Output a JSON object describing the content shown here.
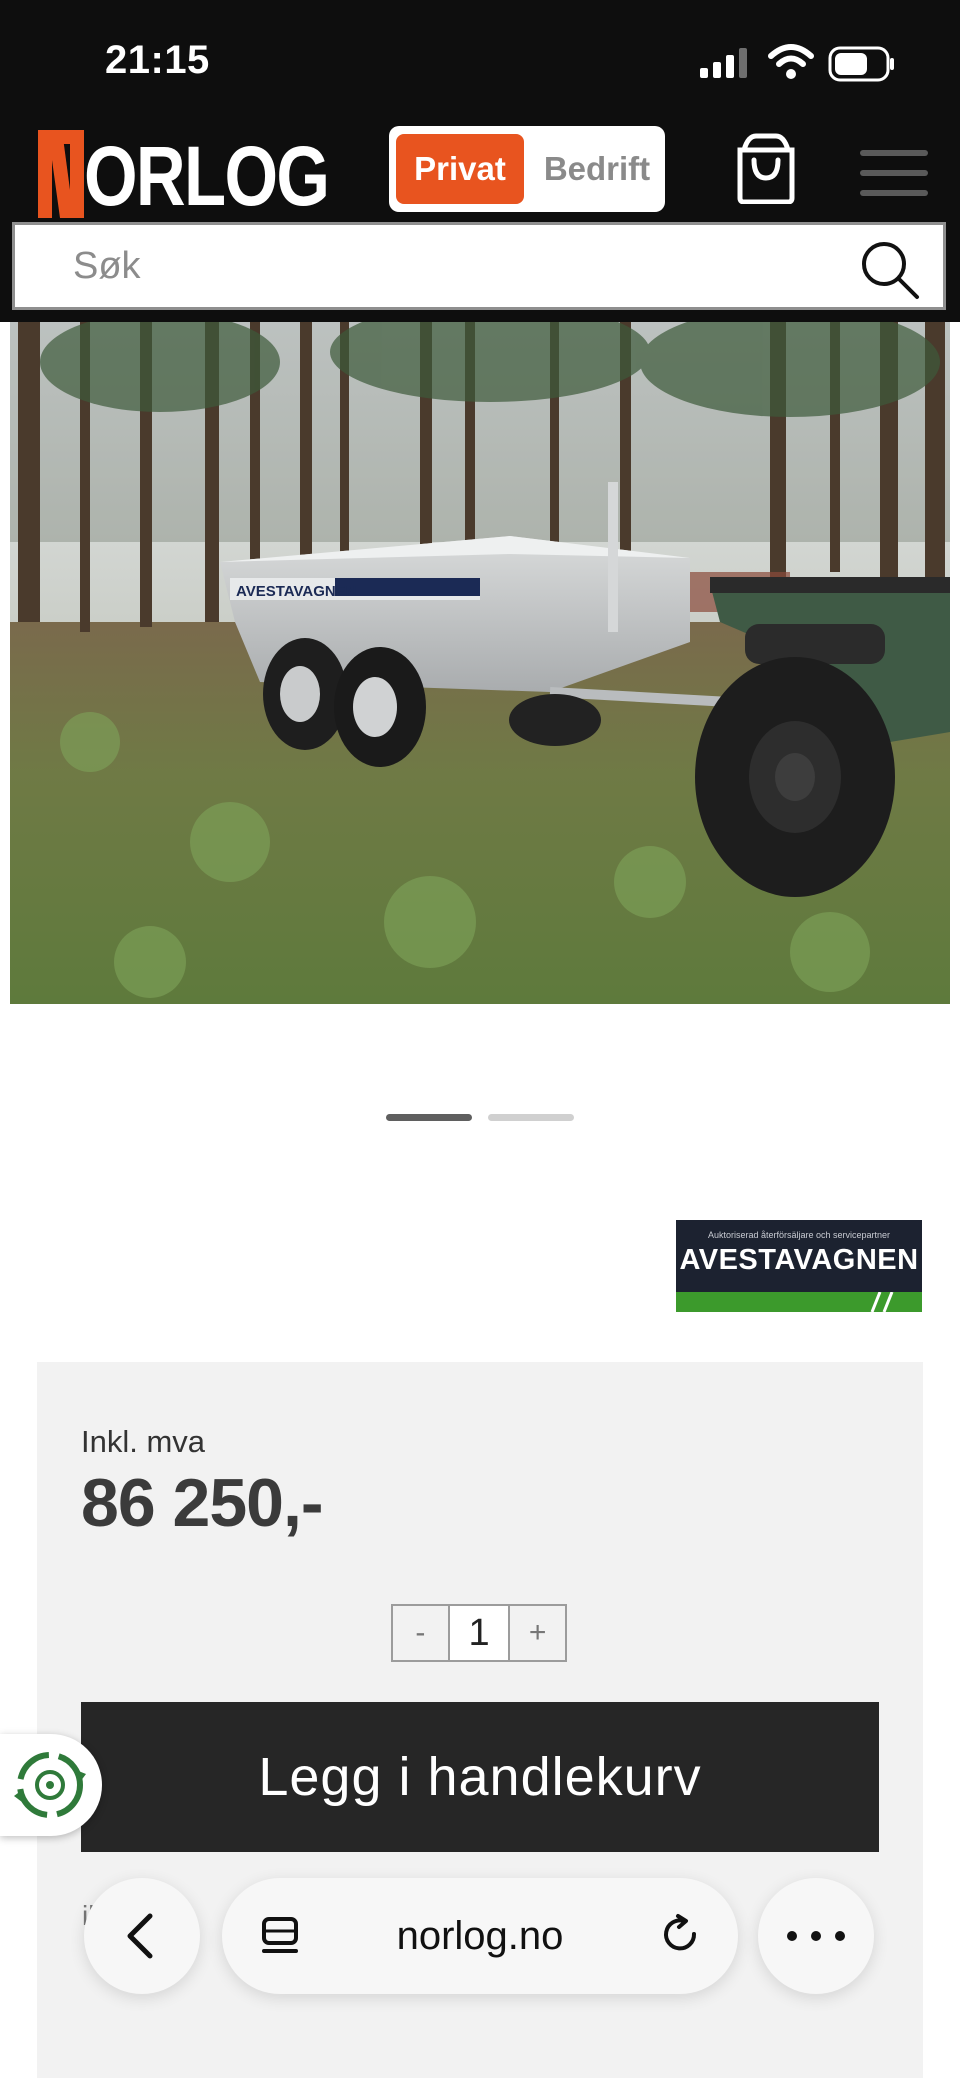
{
  "status_bar": {
    "time": "21:15"
  },
  "header": {
    "logo_text": "NORLOG",
    "segment": {
      "privat": "Privat",
      "bedrift": "Bedrift",
      "selected": "Privat"
    },
    "accent_color": "#e8541f"
  },
  "search": {
    "placeholder": "Søk"
  },
  "gallery": {
    "slide_count": 2,
    "active_index": 0,
    "image_caption_text": "AVESTAVAGNEN"
  },
  "partner_badge": {
    "small_text": "Auktoriserad återförsäljare och servicepartner",
    "name": "AVESTAVAGNEN"
  },
  "pricing": {
    "vat_label": "Inkl. mva",
    "price": "86 250,-",
    "quantity": "1",
    "minus_label": "-",
    "plus_label": "+",
    "add_to_cart_label": "Legg i handlekurv"
  },
  "browser": {
    "url": "norlog.no",
    "partially_hidden_text": "illi"
  }
}
